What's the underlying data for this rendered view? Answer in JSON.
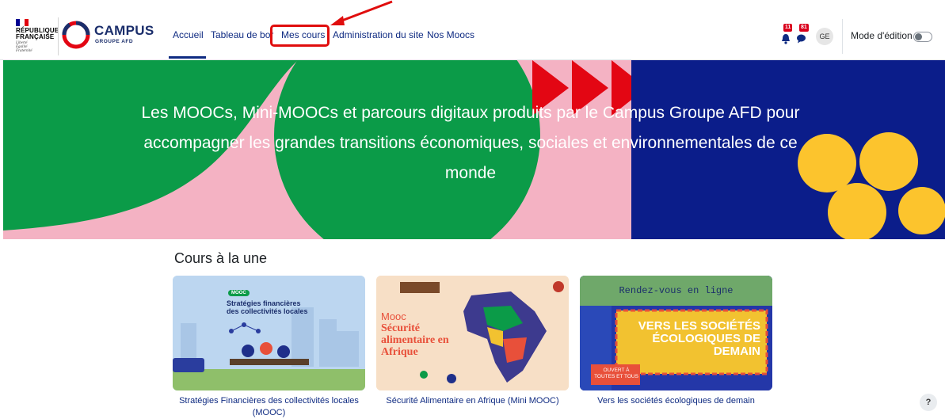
{
  "branding": {
    "republic_line1": "RÉPUBLIQUE",
    "republic_line2": "FRANÇAISE",
    "republic_motto": "Liberté\nÉgalité\nFraternité",
    "campus_name": "CAMPUS",
    "campus_sub": "GROUPE AFD"
  },
  "nav": {
    "items": [
      {
        "label": "Accueil"
      },
      {
        "label": "Tableau de bor"
      },
      {
        "label": "Mes cours"
      },
      {
        "label": "Administration du site"
      },
      {
        "label": "Nos Moocs"
      }
    ],
    "active_item": "Accueil",
    "highlighted_item": "Mes cours"
  },
  "header_right": {
    "notification_count": "11",
    "message_count": "81",
    "user_initials": "GE",
    "edit_mode_label": "Mode d'édition",
    "edit_mode_on": false
  },
  "hero": {
    "text": "Les MOOCs, Mini-MOOCs et parcours digitaux produits par le Campus Groupe AFD pour accompagner les grandes transitions économiques, sociales et environnementales de ce monde"
  },
  "featured": {
    "title": "Cours à la une",
    "courses": [
      {
        "title": "Stratégies Financières des collectivités locales (MOOC)",
        "image_badge": "MOOC",
        "image_text": "Stratégies financières des collectivités locales"
      },
      {
        "title": "Sécurité Alimentaire en Afrique (Mini MOOC)",
        "image_pretitle": "Mooc",
        "image_text": "Sécurité alimentaire en Afrique"
      },
      {
        "title": "Vers les sociétés écologiques de demain",
        "image_top": "Rendez-vous en ligne",
        "image_text": "VERS LES SOCIÉTÉS ÉCOLOGIQUES DE DEMAIN",
        "image_tag": "OUVERT À TOUTES ET TOUS"
      }
    ]
  },
  "help_label": "?",
  "colors": {
    "nav_link": "#0f2b82",
    "annotation_red": "#e00d0d",
    "hero_green": "#0b9b48",
    "hero_pink": "#f4b2c3",
    "hero_blue": "#0b1d8a",
    "hero_yellow": "#fcc42d",
    "hero_red": "#e30613"
  }
}
